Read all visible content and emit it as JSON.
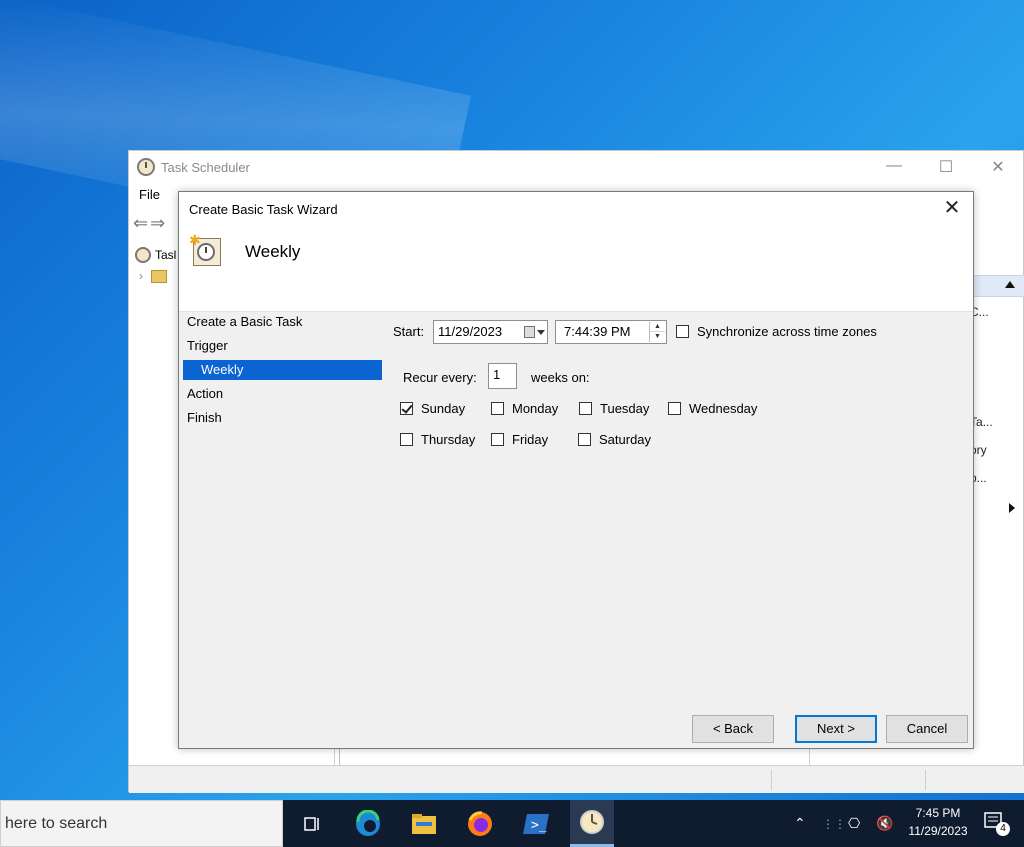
{
  "desktop": {},
  "main_window": {
    "title": "Task Scheduler",
    "menu_file": "File",
    "tree_item_1": "Tasl",
    "right_panel_snippets": [
      "C...",
      "Ta...",
      "ory",
      "o..."
    ]
  },
  "wizard": {
    "title": "Create Basic Task Wizard",
    "heading": "Weekly",
    "steps": [
      "Create a Basic Task",
      "Trigger",
      "Weekly",
      "Action",
      "Finish"
    ],
    "start_label": "Start:",
    "start_date": "11/29/2023",
    "start_time": "7:44:39 PM",
    "sync_label": "Synchronize across time zones",
    "sync_checked": false,
    "recur_label": "Recur every:",
    "recur_value": "1",
    "weeks_on_label": "weeks on:",
    "days": [
      {
        "label": "Sunday",
        "checked": true
      },
      {
        "label": "Monday",
        "checked": false
      },
      {
        "label": "Tuesday",
        "checked": false
      },
      {
        "label": "Wednesday",
        "checked": false
      },
      {
        "label": "Thursday",
        "checked": false
      },
      {
        "label": "Friday",
        "checked": false
      },
      {
        "label": "Saturday",
        "checked": false
      }
    ],
    "buttons": {
      "back": "< Back",
      "next": "Next >",
      "cancel": "Cancel"
    }
  },
  "taskbar": {
    "search_text": "here to search",
    "time": "7:45 PM",
    "date": "11/29/2023",
    "notification_count": "4"
  },
  "colors": {
    "selection": "#0a64d2",
    "default_button_border": "#0078d7",
    "taskbar": "#0f1b2e"
  }
}
